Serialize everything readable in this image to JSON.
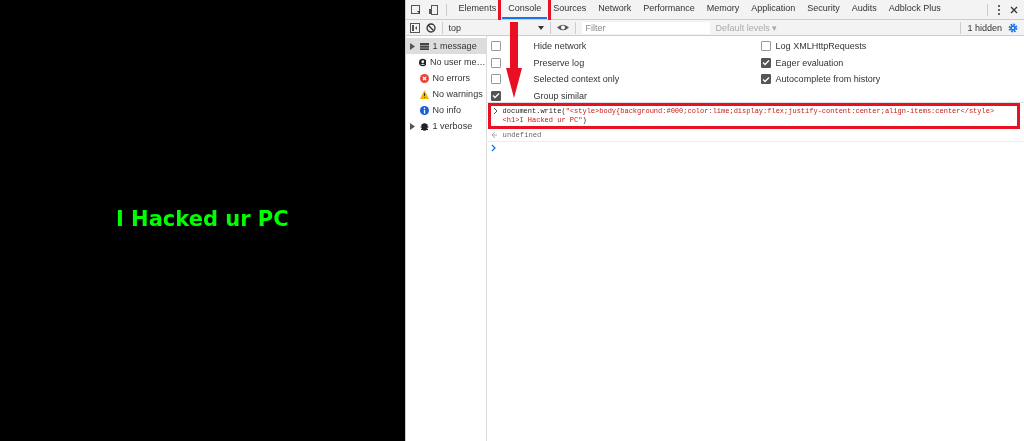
{
  "page": {
    "heading": "I Hacked ur PC"
  },
  "devtools": {
    "tabs": [
      {
        "label": "Elements",
        "selected": false,
        "highlighted": false
      },
      {
        "label": "Console",
        "selected": true,
        "highlighted": true
      },
      {
        "label": "Sources",
        "selected": false,
        "highlighted": false
      },
      {
        "label": "Network",
        "selected": false,
        "highlighted": false
      },
      {
        "label": "Performance",
        "selected": false,
        "highlighted": false
      },
      {
        "label": "Memory",
        "selected": false,
        "highlighted": false
      },
      {
        "label": "Application",
        "selected": false,
        "highlighted": false
      },
      {
        "label": "Security",
        "selected": false,
        "highlighted": false
      },
      {
        "label": "Audits",
        "selected": false,
        "highlighted": false
      },
      {
        "label": "Adblock Plus",
        "selected": false,
        "highlighted": false
      }
    ],
    "toolbar": {
      "context": "top",
      "filter_placeholder": "Filter",
      "levels": "Default levels ▾",
      "hidden_count": "1 hidden"
    },
    "sidebar": {
      "items": [
        {
          "kind": "all",
          "label": "1 message",
          "expandable": true,
          "selected": true
        },
        {
          "kind": "user",
          "label": "No user me…",
          "expandable": false,
          "selected": false
        },
        {
          "kind": "error",
          "label": "No errors",
          "expandable": false,
          "selected": false
        },
        {
          "kind": "warning",
          "label": "No warnings",
          "expandable": false,
          "selected": false
        },
        {
          "kind": "info",
          "label": "No info",
          "expandable": false,
          "selected": false
        },
        {
          "kind": "verbose",
          "label": "1 verbose",
          "expandable": true,
          "selected": false
        }
      ]
    },
    "settings": [
      {
        "label": "Hide network",
        "checked": false
      },
      {
        "label": "Log XMLHttpRequests",
        "checked": false
      },
      {
        "label": "Preserve log",
        "checked": false
      },
      {
        "label": "Eager evaluation",
        "checked": true
      },
      {
        "label": "Selected context only",
        "checked": false
      },
      {
        "label": "Autocomplete from history",
        "checked": true
      },
      {
        "label": "Group similar",
        "checked": true
      }
    ],
    "console": {
      "entries": [
        {
          "kind": "input",
          "highlighted": true,
          "lines": [
            [
              {
                "kind": "plain",
                "text": "document.write("
              },
              {
                "kind": "string",
                "text": "\"<style>body{background:#000;color:lime;display:flex;justify-content:center;align-items:center</style>"
              }
            ],
            [
              {
                "kind": "string",
                "text": "<h1>I Hacked ur PC\""
              },
              {
                "kind": "plain",
                "text": ")"
              }
            ]
          ]
        },
        {
          "kind": "result",
          "highlighted": false,
          "text": "undefined"
        }
      ]
    }
  }
}
